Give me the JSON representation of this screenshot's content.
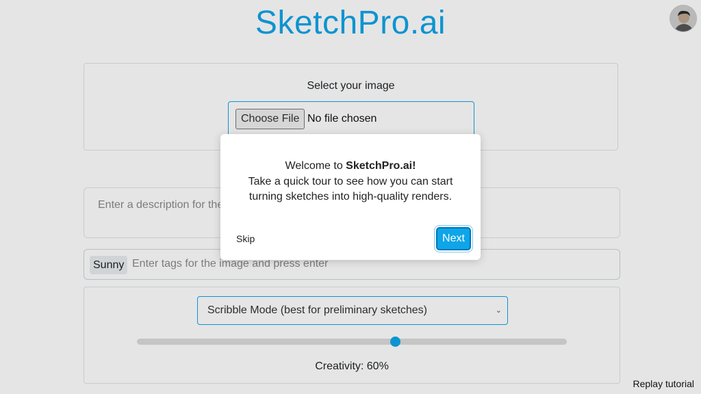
{
  "app": {
    "title": "SketchPro.ai"
  },
  "upload": {
    "label": "Select your image",
    "choose_button": "Choose File",
    "status": "No file chosen"
  },
  "description": {
    "placeholder": "Enter a description for the image"
  },
  "tags": {
    "chips": [
      "Sunny"
    ],
    "placeholder": "Enter tags for the image and press enter"
  },
  "mode": {
    "selected": "Scribble Mode (best for preliminary sketches)",
    "chevron_icon": "chevron-down-icon"
  },
  "creativity": {
    "label": "Creativity: 60%",
    "value": 0.6
  },
  "modal": {
    "line1_prefix": "Welcome to ",
    "line1_bold": "SketchPro.ai!",
    "line2": "Take a quick tour to see how you can start",
    "line3": "turning sketches into high-quality renders.",
    "skip_label": "Skip",
    "next_label": "Next"
  },
  "footer": {
    "replay_label": "Replay tutorial"
  },
  "colors": {
    "accent": "#0ea5e9",
    "overlay": "rgba(0,0,0,0.10)"
  }
}
